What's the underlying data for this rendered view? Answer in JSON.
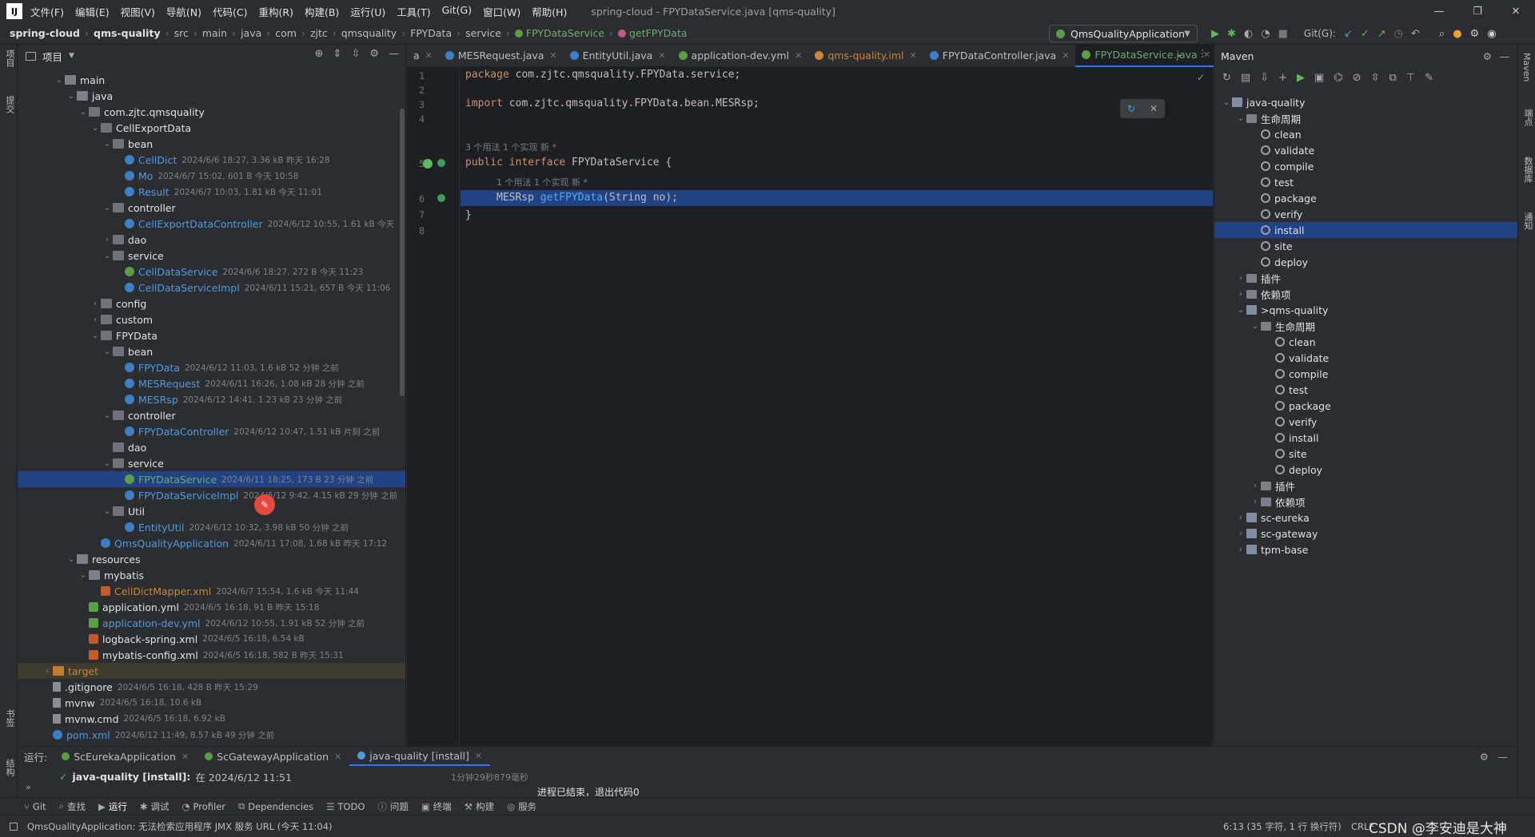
{
  "titlebar": {
    "logo": "IJ",
    "menu": [
      "文件(F)",
      "编辑(E)",
      "视图(V)",
      "导航(N)",
      "代码(C)",
      "重构(R)",
      "构建(B)",
      "运行(U)",
      "工具(T)",
      "Git(G)",
      "窗口(W)",
      "帮助(H)"
    ],
    "title": "spring-cloud - FPYDataService.java [qms-quality]",
    "minimize": "—",
    "maximize": "❐",
    "close": "✕"
  },
  "navbar": {
    "crumbs": [
      "spring-cloud",
      "qms-quality",
      "src",
      "main",
      "java",
      "com",
      "zjtc",
      "qmsquality",
      "FPYData",
      "service",
      "FPYDataService",
      "getFPYData"
    ],
    "run_config": "QmsQualityApplication",
    "git_label": "Git(G):"
  },
  "leftstrip": {
    "project": "项目",
    "commit": "提交",
    "bookmarks": "书签",
    "structure": "结构"
  },
  "rightstrip": {
    "maven": "Maven",
    "gradle": "端点",
    "database": "数据库",
    "notifications": "通知"
  },
  "project": {
    "header": "项目",
    "tree": [
      {
        "depth": 3,
        "arrow": "⌄",
        "icon": "folder",
        "name": "main",
        "meta": "",
        "style": ""
      },
      {
        "depth": 4,
        "arrow": "⌄",
        "icon": "folder",
        "name": "java",
        "meta": "",
        "style": ""
      },
      {
        "depth": 5,
        "arrow": "⌄",
        "icon": "pkg",
        "name": "com.zjtc.qmsquality",
        "meta": "",
        "style": ""
      },
      {
        "depth": 6,
        "arrow": "⌄",
        "icon": "pkg",
        "name": "CellExportData",
        "meta": "",
        "style": ""
      },
      {
        "depth": 7,
        "arrow": "⌄",
        "icon": "pkg",
        "name": "bean",
        "meta": "",
        "style": ""
      },
      {
        "depth": 8,
        "arrow": "",
        "icon": "cls",
        "name": "CellDict",
        "meta": "2024/6/6 18:27, 3.36 kB 昨天 16:28",
        "style": "blue"
      },
      {
        "depth": 8,
        "arrow": "",
        "icon": "cls",
        "name": "Mo",
        "meta": "2024/6/7 15:02, 601 B 今天 10:58",
        "style": "blue"
      },
      {
        "depth": 8,
        "arrow": "",
        "icon": "cls",
        "name": "Result",
        "meta": "2024/6/7 10:03, 1.81 kB 今天 11:01",
        "style": "blue"
      },
      {
        "depth": 7,
        "arrow": "⌄",
        "icon": "pkg",
        "name": "controller",
        "meta": "",
        "style": ""
      },
      {
        "depth": 8,
        "arrow": "",
        "icon": "cls",
        "name": "CellExportDataController",
        "meta": "2024/6/12 10:55, 1.61 kB 今天",
        "style": "blue"
      },
      {
        "depth": 7,
        "arrow": "›",
        "icon": "pkg",
        "name": "dao",
        "meta": "",
        "style": ""
      },
      {
        "depth": 7,
        "arrow": "⌄",
        "icon": "pkg",
        "name": "service",
        "meta": "",
        "style": ""
      },
      {
        "depth": 8,
        "arrow": "",
        "icon": "ifc",
        "name": "CellDataService",
        "meta": "2024/6/6 18:27, 272 B 今天 11:23",
        "style": "blue"
      },
      {
        "depth": 8,
        "arrow": "",
        "icon": "cls",
        "name": "CellDataServiceImpl",
        "meta": "2024/6/11 15:21, 657 B 今天 11:06",
        "style": "blue"
      },
      {
        "depth": 6,
        "arrow": "›",
        "icon": "pkg",
        "name": "config",
        "meta": "",
        "style": ""
      },
      {
        "depth": 6,
        "arrow": "›",
        "icon": "pkg",
        "name": "custom",
        "meta": "",
        "style": ""
      },
      {
        "depth": 6,
        "arrow": "⌄",
        "icon": "pkg",
        "name": "FPYData",
        "meta": "",
        "style": ""
      },
      {
        "depth": 7,
        "arrow": "⌄",
        "icon": "pkg",
        "name": "bean",
        "meta": "",
        "style": ""
      },
      {
        "depth": 8,
        "arrow": "",
        "icon": "cls",
        "name": "FPYData",
        "meta": "2024/6/12 11:03, 1.6 kB 52 分钟 之前",
        "style": "blue"
      },
      {
        "depth": 8,
        "arrow": "",
        "icon": "cls",
        "name": "MESRequest",
        "meta": "2024/6/11 16:26, 1.08 kB 28 分钟 之前",
        "style": "blue"
      },
      {
        "depth": 8,
        "arrow": "",
        "icon": "cls",
        "name": "MESRsp",
        "meta": "2024/6/12 14:41, 1.23 kB 23 分钟 之前",
        "style": "blue"
      },
      {
        "depth": 7,
        "arrow": "⌄",
        "icon": "pkg",
        "name": "controller",
        "meta": "",
        "style": ""
      },
      {
        "depth": 8,
        "arrow": "",
        "icon": "cls",
        "name": "FPYDataController",
        "meta": "2024/6/12 10:47, 1.51 kB 片刻 之前",
        "style": "blue"
      },
      {
        "depth": 7,
        "arrow": "",
        "icon": "pkg",
        "name": "dao",
        "meta": "",
        "style": ""
      },
      {
        "depth": 7,
        "arrow": "⌄",
        "icon": "pkg",
        "name": "service",
        "meta": "",
        "style": ""
      },
      {
        "depth": 8,
        "arrow": "",
        "icon": "ifc",
        "name": "FPYDataService",
        "meta": "2024/6/11 18:25, 173 B 23 分钟 之前",
        "style": "green"
      },
      {
        "depth": 8,
        "arrow": "",
        "icon": "cls",
        "name": "FPYDataServiceImpl",
        "meta": "2024/6/12 9:42, 4.15 kB 29 分钟 之前",
        "style": "blue"
      },
      {
        "depth": 7,
        "arrow": "⌄",
        "icon": "pkg",
        "name": "Util",
        "meta": "",
        "style": ""
      },
      {
        "depth": 8,
        "arrow": "",
        "icon": "cls",
        "name": "EntityUtil",
        "meta": "2024/6/12 10:32, 3.98 kB 50 分钟 之前",
        "style": "blue"
      },
      {
        "depth": 6,
        "arrow": "",
        "icon": "app",
        "name": "QmsQualityApplication",
        "meta": "2024/6/11 17:08, 1.68 kB 昨天 17:12",
        "style": "blue"
      },
      {
        "depth": 4,
        "arrow": "⌄",
        "icon": "folder",
        "name": "resources",
        "meta": "",
        "style": ""
      },
      {
        "depth": 5,
        "arrow": "⌄",
        "icon": "folder",
        "name": "mybatis",
        "meta": "",
        "style": ""
      },
      {
        "depth": 6,
        "arrow": "",
        "icon": "xml",
        "name": "CellDictMapper.xml",
        "meta": "2024/6/7 15:54, 1.6 kB 今天 11:44",
        "style": "orange"
      },
      {
        "depth": 5,
        "arrow": "",
        "icon": "yml",
        "name": "application.yml",
        "meta": "2024/6/5 16:18, 91 B 昨天 15:18",
        "style": ""
      },
      {
        "depth": 5,
        "arrow": "",
        "icon": "yml",
        "name": "application-dev.yml",
        "meta": "2024/6/12 10:55, 1.91 kB 52 分钟 之前",
        "style": "blue"
      },
      {
        "depth": 5,
        "arrow": "",
        "icon": "xml",
        "name": "logback-spring.xml",
        "meta": "2024/6/5 16:18, 6.54 kB",
        "style": ""
      },
      {
        "depth": 5,
        "arrow": "",
        "icon": "xml",
        "name": "mybatis-config.xml",
        "meta": "2024/6/5 16:18, 582 B 昨天 15:31",
        "style": ""
      },
      {
        "depth": 2,
        "arrow": "›",
        "icon": "folderO",
        "name": "target",
        "meta": "",
        "style": "orange"
      },
      {
        "depth": 2,
        "arrow": "",
        "icon": "file",
        "name": ".gitignore",
        "meta": "2024/6/5 16:18, 428 B 昨天 15:29",
        "style": ""
      },
      {
        "depth": 2,
        "arrow": "",
        "icon": "file",
        "name": "mvnw",
        "meta": "2024/6/5 16:18, 10.6 kB",
        "style": ""
      },
      {
        "depth": 2,
        "arrow": "",
        "icon": "file",
        "name": "mvnw.cmd",
        "meta": "2024/6/5 16:18, 6.92 kB",
        "style": ""
      },
      {
        "depth": 2,
        "arrow": "",
        "icon": "cls",
        "name": "pom.xml",
        "meta": "2024/6/12 11:49, 8.57 kB 49 分钟 之前",
        "style": "blue"
      }
    ]
  },
  "tabs": [
    {
      "label": "a",
      "color": "",
      "active": false
    },
    {
      "label": "MESRequest.java",
      "color": "#3c7fc4",
      "active": false
    },
    {
      "label": "EntityUtil.java",
      "color": "#3c7fc4",
      "active": false
    },
    {
      "label": "application-dev.yml",
      "color": "#5a9f48",
      "active": false
    },
    {
      "label": "qms-quality.iml",
      "color": "#c9853a",
      "active": false
    },
    {
      "label": "FPYDataController.java",
      "color": "#3c7fc4",
      "active": false
    },
    {
      "label": "FPYDataService.java",
      "color": "#5a9f48",
      "active": true
    }
  ],
  "editor": {
    "lines": [
      "1",
      "2",
      "3",
      "",
      "5",
      "",
      "6",
      "7",
      "8"
    ],
    "l1_kw": "package",
    "l1_rest": " com.zjtc.qmsquality.FPYData.service;",
    "l3_kw": "import",
    "l3_rest": " com.zjtc.qmsquality.FPYData.bean.MESRsp;",
    "hint1": "3 个用法   1 个实现   新 *",
    "l5_kw": "public interface",
    "l5_rest": " FPYDataService {",
    "hint2": "1 个用法   1 个实现   新 *",
    "l6_type": "MESRsp ",
    "l6_fn": "getFPYData",
    "l6_rest": "(String no);",
    "l7": "}"
  },
  "maven": {
    "header": "Maven",
    "rows": [
      {
        "depth": 0,
        "arrow": "⌄",
        "icon": "mi",
        "name": "java-quality"
      },
      {
        "depth": 1,
        "arrow": "⌄",
        "icon": "fi",
        "name": "生命周期"
      },
      {
        "depth": 2,
        "arrow": "",
        "icon": "gear",
        "name": "clean"
      },
      {
        "depth": 2,
        "arrow": "",
        "icon": "gear",
        "name": "validate"
      },
      {
        "depth": 2,
        "arrow": "",
        "icon": "gear",
        "name": "compile"
      },
      {
        "depth": 2,
        "arrow": "",
        "icon": "gear",
        "name": "test"
      },
      {
        "depth": 2,
        "arrow": "",
        "icon": "gear",
        "name": "package"
      },
      {
        "depth": 2,
        "arrow": "",
        "icon": "gear",
        "name": "verify"
      },
      {
        "depth": 2,
        "arrow": "",
        "icon": "gear",
        "name": "install"
      },
      {
        "depth": 2,
        "arrow": "",
        "icon": "gear",
        "name": "site"
      },
      {
        "depth": 2,
        "arrow": "",
        "icon": "gear",
        "name": "deploy"
      },
      {
        "depth": 1,
        "arrow": "›",
        "icon": "fi",
        "name": "插件"
      },
      {
        "depth": 1,
        "arrow": "›",
        "icon": "fi",
        "name": "依赖项"
      },
      {
        "depth": 1,
        "arrow": "⌄",
        "icon": "mi",
        "name": ">qms-quality"
      },
      {
        "depth": 2,
        "arrow": "⌄",
        "icon": "fi",
        "name": "生命周期"
      },
      {
        "depth": 3,
        "arrow": "",
        "icon": "gear",
        "name": "clean"
      },
      {
        "depth": 3,
        "arrow": "",
        "icon": "gear",
        "name": "validate"
      },
      {
        "depth": 3,
        "arrow": "",
        "icon": "gear",
        "name": "compile"
      },
      {
        "depth": 3,
        "arrow": "",
        "icon": "gear",
        "name": "test"
      },
      {
        "depth": 3,
        "arrow": "",
        "icon": "gear",
        "name": "package"
      },
      {
        "depth": 3,
        "arrow": "",
        "icon": "gear",
        "name": "verify"
      },
      {
        "depth": 3,
        "arrow": "",
        "icon": "gear",
        "name": "install"
      },
      {
        "depth": 3,
        "arrow": "",
        "icon": "gear",
        "name": "site"
      },
      {
        "depth": 3,
        "arrow": "",
        "icon": "gear",
        "name": "deploy"
      },
      {
        "depth": 2,
        "arrow": "›",
        "icon": "fi",
        "name": "插件"
      },
      {
        "depth": 2,
        "arrow": "›",
        "icon": "fi",
        "name": "依赖项"
      },
      {
        "depth": 1,
        "arrow": "›",
        "icon": "mi",
        "name": "sc-eureka"
      },
      {
        "depth": 1,
        "arrow": "›",
        "icon": "mi",
        "name": "sc-gateway"
      },
      {
        "depth": 1,
        "arrow": "›",
        "icon": "mi",
        "name": "tpm-base"
      }
    ]
  },
  "run": {
    "label": "运行:",
    "tabs": [
      "ScEurekaApplication",
      "ScGatewayApplication",
      "java-quality [install]"
    ],
    "task": "java-quality [install]:",
    "task_time": "在 2024/6/12 11:51",
    "duration": "1分钟29秒879毫秒",
    "output": "进程已结束，退出代码0"
  },
  "toolwindows": [
    "Git",
    "查找",
    "运行",
    "调试",
    "Profiler",
    "Dependencies",
    "TODO",
    "问题",
    "终端",
    "构建",
    "服务"
  ],
  "status": {
    "message": "QmsQualityApplication: 无法检索应用程序 JMX 服务 URL (今天 11:04)",
    "position": "6:13 (35 字符, 1 行 换行符)",
    "crlf": "CRLF",
    "watermark": "CSDN @李安迪是大神"
  }
}
